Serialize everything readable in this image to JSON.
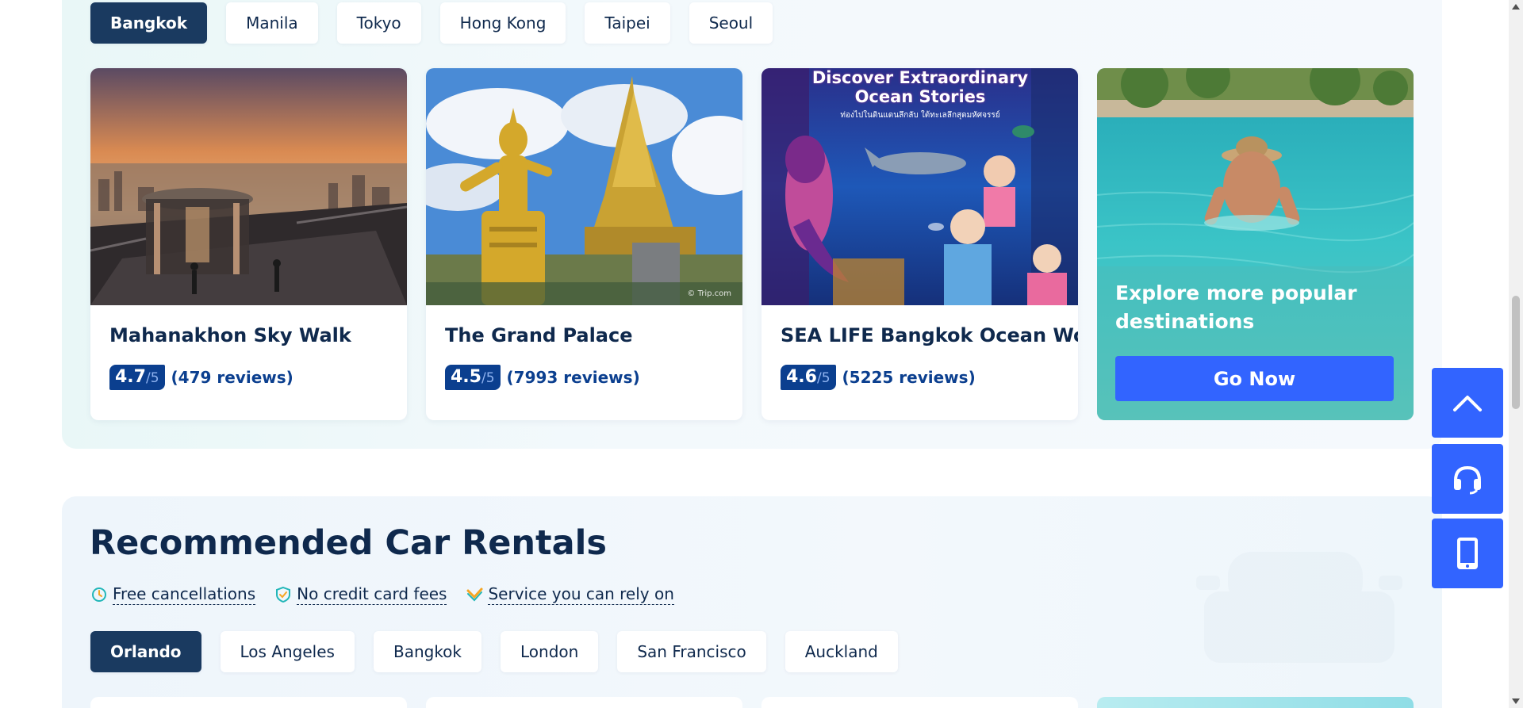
{
  "attractions": {
    "cities": [
      "Bangkok",
      "Manila",
      "Tokyo",
      "Hong Kong",
      "Taipei",
      "Seoul"
    ],
    "active_city": "Bangkok",
    "cards": [
      {
        "title": "Mahanakhon Sky Walk",
        "score": "4.7",
        "out_of": "/5",
        "reviews": "(479 reviews)"
      },
      {
        "title": "The Grand Palace",
        "score": "4.5",
        "out_of": "/5",
        "reviews": "(7993 reviews)"
      },
      {
        "title": "SEA LIFE Bangkok Ocean World",
        "score": "4.6",
        "out_of": "/5",
        "reviews": "(5225 reviews)",
        "image_headline": "Discover Extraordinary Ocean Stories",
        "image_subline": "ท่องไปในดินแดนลึกลับ ใต้ทะเลลึกสุดมหัศจรรย์"
      },
      {
        "image_credit": "© Trip.com"
      }
    ],
    "promo": {
      "text": "Explore more popular destinations",
      "button": "Go Now"
    }
  },
  "car_rentals": {
    "title": "Recommended Car Rentals",
    "features": [
      "Free cancellations",
      "No credit card fees",
      "Service you can rely on"
    ],
    "cities": [
      "Orlando",
      "Los Angeles",
      "Bangkok",
      "London",
      "San Francisco",
      "Auckland"
    ],
    "active_city": "Orlando"
  },
  "floating": {
    "icons": [
      "chevron-up-icon",
      "headset-icon",
      "mobile-phone-icon"
    ]
  },
  "colors": {
    "navy": "#0f294d",
    "active_tab": "#1a3a60",
    "brand_blue": "#3264ff",
    "score_blue": "#0b3f8f"
  }
}
